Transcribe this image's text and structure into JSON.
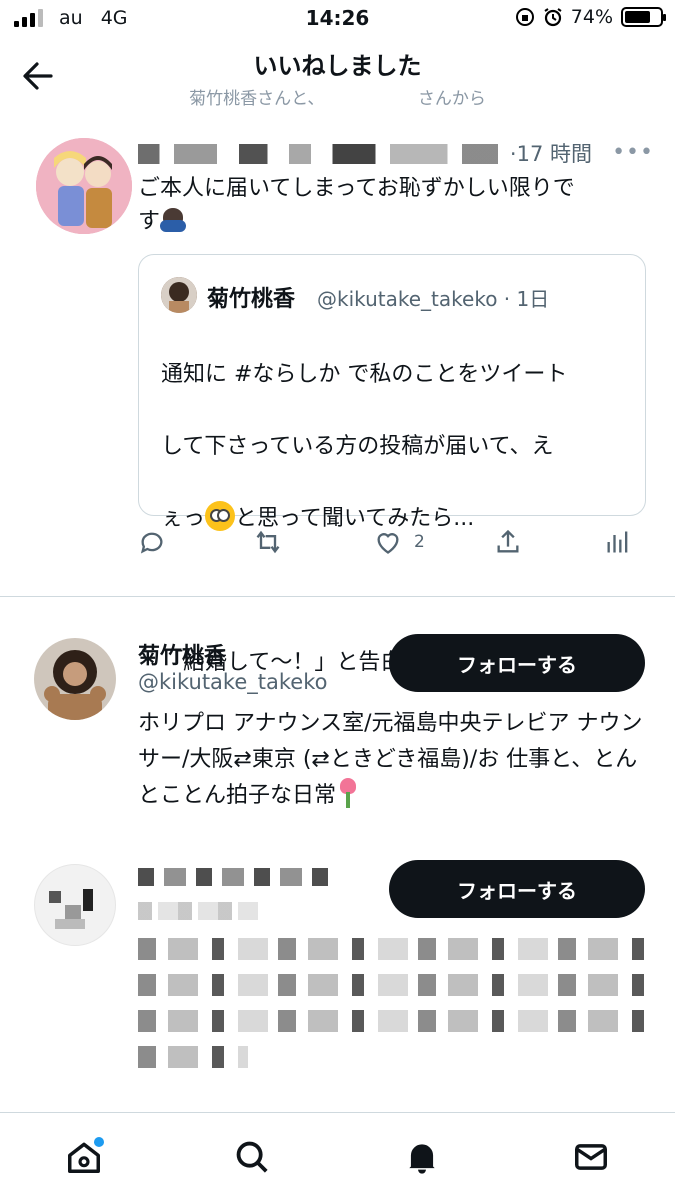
{
  "status_bar": {
    "carrier": "au",
    "network": "4G",
    "time": "14:26",
    "battery": "74%"
  },
  "header": {
    "title": "いいねしました",
    "subtitle": "菊竹桃香さんと、　　　　　　さんから"
  },
  "tweet": {
    "time": "·17 時間",
    "text_line1": "ご本人に届いてしまってお恥ずかしい限りで",
    "text_line2": "す",
    "quote": {
      "name": "菊竹桃香",
      "handle": "@kikutake_takeko · 1日",
      "line1": "通知に #ならしか で私のことをツイート",
      "line2": "して下さっている方の投稿が届いて、え",
      "line3_a": "ぇっ",
      "line3_b": "と思って聞いてみたら...",
      "line5": "「結婚して〜！」と告白されていまし..."
    },
    "actions": {
      "like_count": "2"
    }
  },
  "users": [
    {
      "name": "菊竹桃香",
      "handle": "@kikutake_takeko",
      "follow_label": "フォローする",
      "bio": "ホリプロ アナウンス室/元福島中央テレビア ナウンサー/大阪⇄東京 (⇄ときどき福島)/お 仕事と、とんとことん拍子な日常"
    },
    {
      "follow_label": "フォローする"
    }
  ],
  "colors": {
    "accent": "#1d9bf0",
    "text": "#0f1419",
    "muted": "#536471",
    "border": "#cfd9de"
  }
}
